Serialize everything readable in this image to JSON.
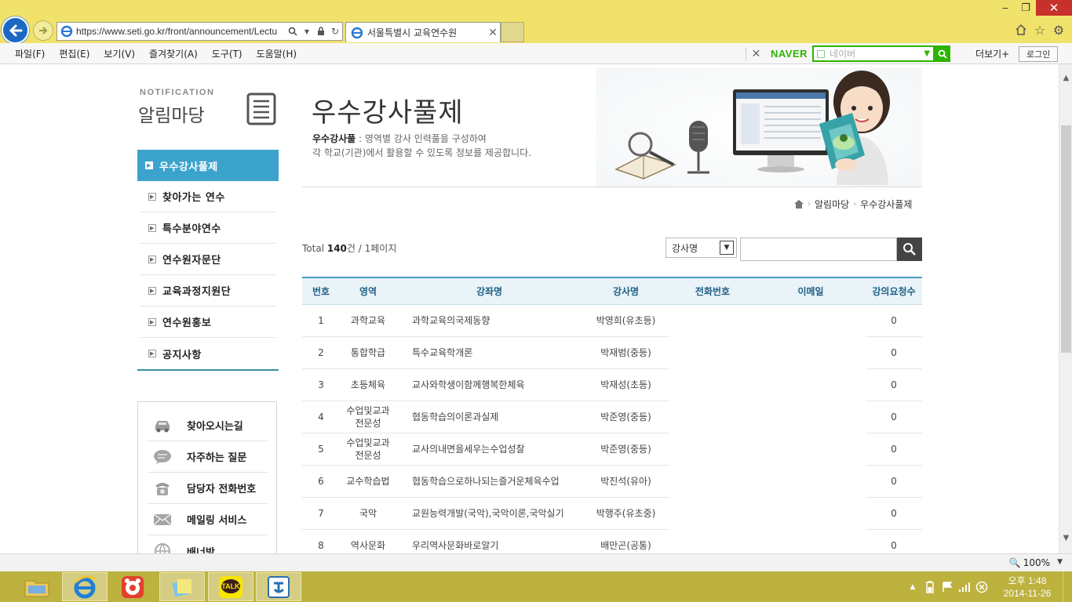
{
  "browser": {
    "url": "https://www.seti.go.kr/front/announcement/Lectu",
    "tab_title": "서울특별시 교육연수원",
    "menu": [
      "파일(F)",
      "편집(E)",
      "보기(V)",
      "즐겨찾기(A)",
      "도구(T)",
      "도움말(H)"
    ],
    "naver_logo": "NAVER",
    "naver_placeholder": "네이버",
    "more_label": "더보기+",
    "login_label": "로그인",
    "zoom": "100%"
  },
  "sidebar": {
    "section_en": "NOTIFICATION",
    "section_ko": "알림마당",
    "items": [
      {
        "label": "우수강사풀제",
        "active": true
      },
      {
        "label": "찾아가는 연수"
      },
      {
        "label": "특수분야연수"
      },
      {
        "label": "연수원자문단"
      },
      {
        "label": "교육과정지원단"
      },
      {
        "label": "연수원홍보"
      },
      {
        "label": "공지사항"
      }
    ],
    "quick_links": [
      {
        "label": "찾아오시는길",
        "icon": "car-icon"
      },
      {
        "label": "자주하는 질문",
        "icon": "chat-bubble-icon"
      },
      {
        "label": "담당자 전화번호",
        "icon": "telephone-icon"
      },
      {
        "label": "메일링 서비스",
        "icon": "mail-icon"
      },
      {
        "label": "배너방",
        "icon": "globe-icon"
      }
    ]
  },
  "main": {
    "title": "우수강사풀제",
    "desc_bold": "우수강사풀",
    "desc_line1": " : 영역별 강사 인력풀을 구성하여",
    "desc_line2": "각 학교(기관)에서 활용할 수 있도록 정보를 제공합니다.",
    "breadcrumb": [
      "알림마당",
      "우수강사풀제"
    ],
    "total_prefix": "Total ",
    "total_count": "140",
    "total_suffix": "건 / 1페이지",
    "search_field": "강사명",
    "table": {
      "headers": [
        "번호",
        "영역",
        "강좌명",
        "강사명",
        "전화번호",
        "이메일",
        "강의요청수"
      ],
      "rows": [
        {
          "no": "1",
          "area": "과학교육",
          "course": "과학교육의국제동향",
          "teacher": "박영희(유초등)",
          "count": "0"
        },
        {
          "no": "2",
          "area": "통합학급",
          "course": "특수교육학개론",
          "teacher": "박재범(중등)",
          "count": "0"
        },
        {
          "no": "3",
          "area": "초등체육",
          "course": "교사와학생이함께행복한체육",
          "teacher": "박재성(초등)",
          "count": "0"
        },
        {
          "no": "4",
          "area": "수업및교과\n전문성",
          "course": "협동학습의이론과실제",
          "teacher": "박준영(중등)",
          "count": "0"
        },
        {
          "no": "5",
          "area": "수업및교과\n전문성",
          "course": "교사의내면을세우는수업성찰",
          "teacher": "박준영(중등)",
          "count": "0"
        },
        {
          "no": "6",
          "area": "교수학습법",
          "course": "협동학습으로하나되는즐거운체육수업",
          "teacher": "박진석(유아)",
          "count": "0"
        },
        {
          "no": "7",
          "area": "국악",
          "course": "교원능력개발(국악),국악이론,국악실기",
          "teacher": "박행주(유초중)",
          "count": "0"
        },
        {
          "no": "8",
          "area": "역사문화",
          "course": "우리역사문화바로알기",
          "teacher": "배만곤(공통)",
          "count": "0"
        }
      ]
    }
  },
  "taskbar": {
    "clock_time": "오후 1:48",
    "clock_date": "2014-11-26",
    "kakao_label": "TALK"
  }
}
